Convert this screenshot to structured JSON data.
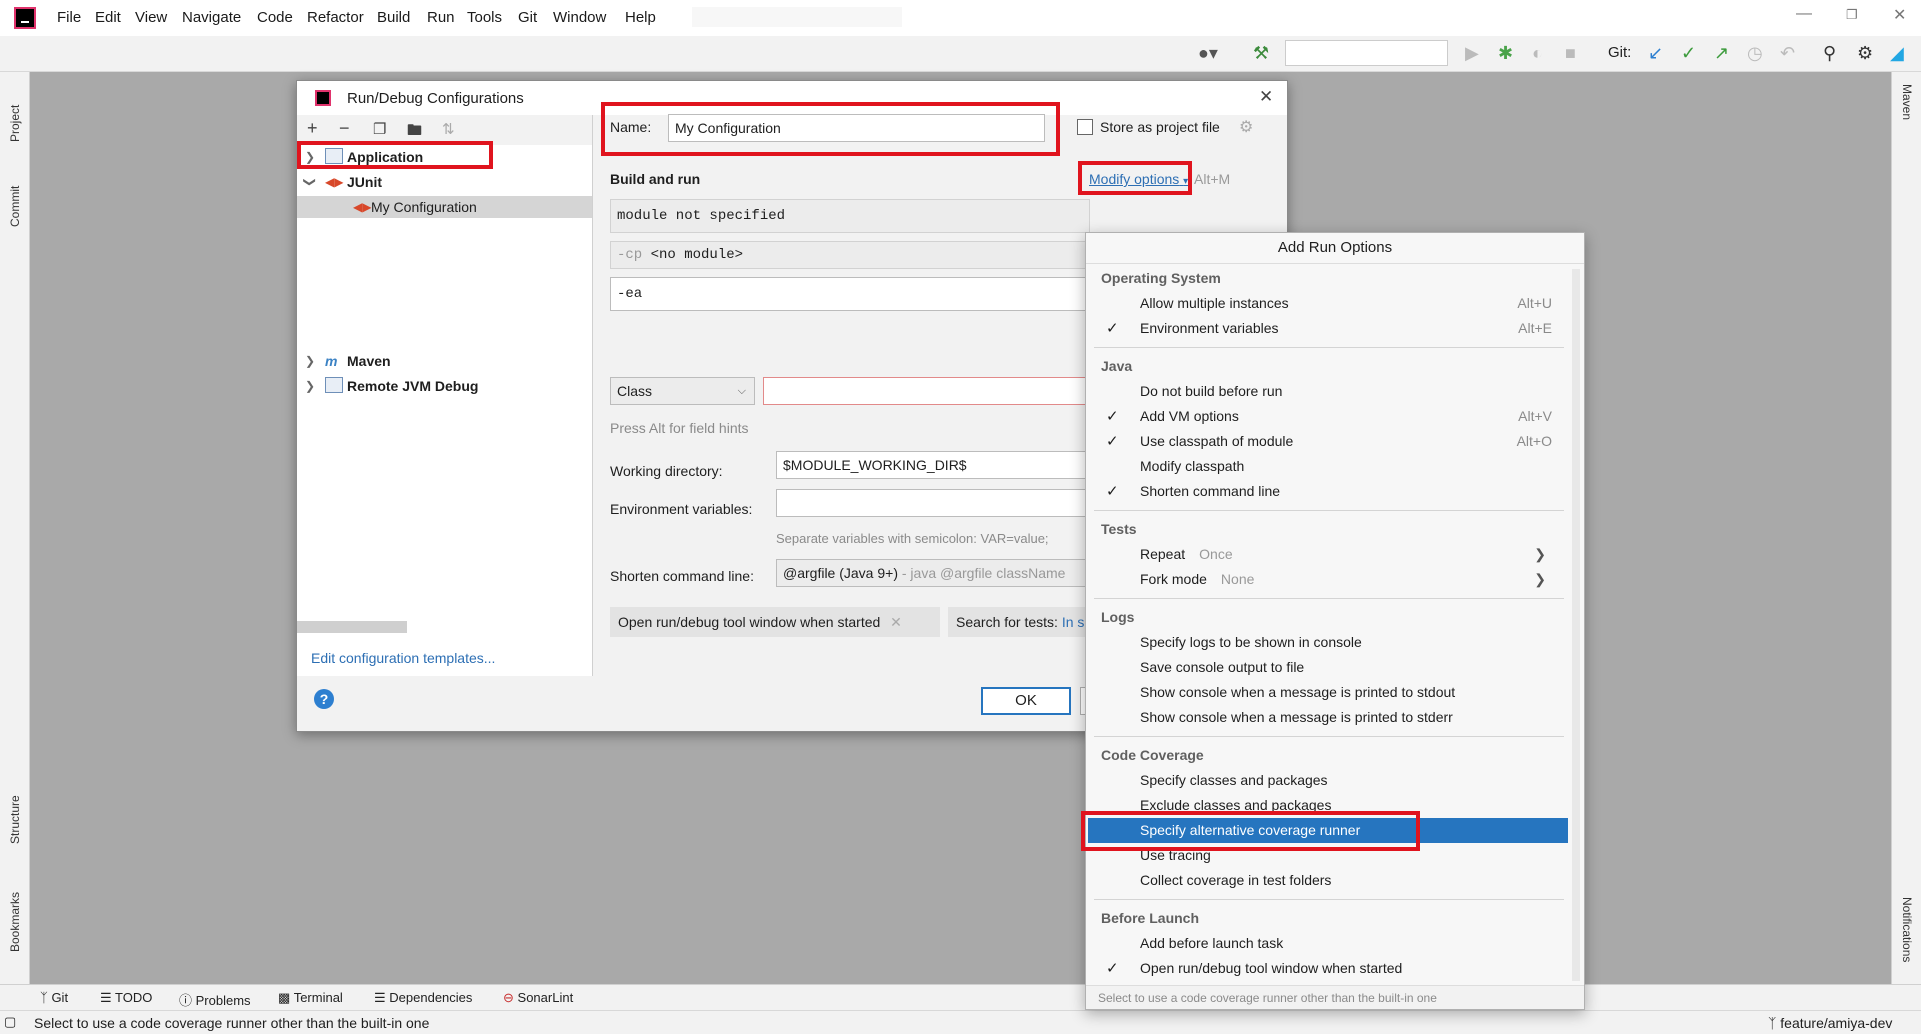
{
  "menubar": {
    "items": [
      "File",
      "Edit",
      "View",
      "Navigate",
      "Code",
      "Refactor",
      "Build",
      "Run",
      "Tools",
      "Git",
      "Window",
      "Help"
    ]
  },
  "toolbar": {
    "git_label": "Git:",
    "icons": [
      "user-icon",
      "hammer-icon",
      "run-icon",
      "debug-icon",
      "coverage-icon",
      "stop-icon",
      "git-update-icon",
      "git-commit-icon",
      "git-push-icon",
      "history-icon",
      "rollback-icon",
      "search-icon",
      "settings-icon",
      "jetbrains-logo-icon"
    ]
  },
  "left_stripe": {
    "project": "Project",
    "commit": "Commit",
    "structure": "Structure",
    "bookmarks": "Bookmarks"
  },
  "right_stripe": {
    "maven": "Maven",
    "notifications": "Notifications"
  },
  "bottom_tabs": [
    "Git",
    "TODO",
    "Problems",
    "Terminal",
    "Dependencies",
    "SonarLint"
  ],
  "status": {
    "message": "Select to use a code coverage runner other than the built-in one",
    "branch": "feature/amiya-dev"
  },
  "dialog": {
    "title": "Run/Debug Configurations",
    "tree": {
      "application": "Application",
      "junit": "JUnit",
      "my_configuration": "My Configuration",
      "maven": "Maven",
      "remote_jvm_debug": "Remote JVM Debug"
    },
    "edit_templates": "Edit configuration templates...",
    "name_label": "Name:",
    "name_value": "My Configuration",
    "store_as_project_file": "Store as project file",
    "build_and_run": "Build and run",
    "modify_options": "Modify options",
    "modify_shortcut": "Alt+M",
    "module_value": "module not specified",
    "cp_prefix": "-cp",
    "cp_value": "<no module>",
    "vm_options": "-ea",
    "class_select": "Class",
    "field_hint": "Press Alt for field hints",
    "working_dir_label": "Working directory:",
    "working_dir_value": "$MODULE_WORKING_DIR$",
    "env_label": "Environment variables:",
    "env_hint": "Separate variables with semicolon: VAR=value;",
    "shorten_label": "Shorten command line:",
    "shorten_value": "@argfile (Java 9+)",
    "shorten_hint": "- java @argfile className",
    "chip_open": "Open run/debug tool window when started",
    "chip_search": "Search for tests:",
    "chip_search_value": "In s",
    "ok": "OK"
  },
  "popup": {
    "title": "Add Run Options",
    "sections": {
      "os": "Operating System",
      "java": "Java",
      "tests": "Tests",
      "logs": "Logs",
      "coverage": "Code Coverage",
      "before": "Before Launch"
    },
    "items": {
      "allow_multiple": {
        "label": "Allow multiple instances",
        "shortcut": "Alt+U"
      },
      "env_vars": {
        "label": "Environment variables",
        "shortcut": "Alt+E"
      },
      "do_not_build": {
        "label": "Do not build before run"
      },
      "add_vm": {
        "label": "Add VM options",
        "shortcut": "Alt+V"
      },
      "use_classpath": {
        "label": "Use classpath of module",
        "shortcut": "Alt+O"
      },
      "modify_classpath": {
        "label": "Modify classpath"
      },
      "shorten_cmd": {
        "label": "Shorten command line"
      },
      "repeat": {
        "label": "Repeat",
        "hint": "Once"
      },
      "fork_mode": {
        "label": "Fork mode",
        "hint": "None"
      },
      "logs_console": {
        "label": "Specify logs to be shown in console"
      },
      "save_console": {
        "label": "Save console output to file"
      },
      "show_stdout": {
        "label": "Show console when a message is printed to stdout"
      },
      "show_stderr": {
        "label": "Show console when a message is printed to stderr"
      },
      "specify_classes": {
        "label": "Specify classes and packages"
      },
      "exclude_classes": {
        "label": "Exclude classes and packages"
      },
      "alt_runner": {
        "label": "Specify alternative coverage runner"
      },
      "use_tracing": {
        "label": "Use tracing"
      },
      "collect_test": {
        "label": "Collect coverage in test folders"
      },
      "add_before": {
        "label": "Add before launch task"
      },
      "open_tool_window": {
        "label": "Open run/debug tool window when started"
      }
    },
    "footer": "Select to use a code coverage runner other than the built-in one"
  },
  "colors": {
    "highlight_red": "#e0141e",
    "selection_blue": "#2675bf",
    "link_blue": "#2d6fb4"
  }
}
